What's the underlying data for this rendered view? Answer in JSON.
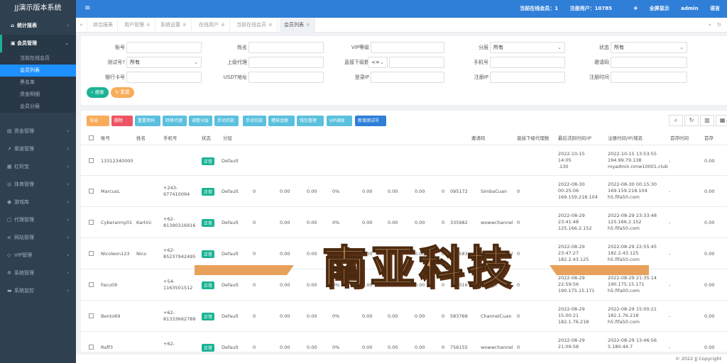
{
  "brand": "JJ演示版本系统",
  "topbar": {
    "online": "当前在线会员：1",
    "registered": "注册用户：10785",
    "fullscreen": "全屏显示",
    "user": "admin",
    "lang": "语言"
  },
  "sidebar": {
    "stats": "统计报表",
    "members": "会员管理",
    "members_sub": [
      "当前在线会员",
      "会员列表",
      "黑名单",
      "资金明细",
      "会员分层"
    ],
    "others": [
      "资金管理",
      "渠道管理",
      "红利宝",
      "体育管理",
      "游戏库",
      "代理管理",
      "网站管理",
      "VIP管理",
      "系统管理",
      "系统监控"
    ]
  },
  "tabs": [
    "综合报表",
    "用户管理",
    "系统设置",
    "在线用户",
    "当前在线会员",
    "会员列表"
  ],
  "search": {
    "labels": [
      "账号",
      "姓名",
      "VIP等级",
      "分层",
      "状态",
      "测试号?",
      "上级代理",
      "直接下级数",
      "手机号",
      "邀请码",
      "银行卡号",
      "USDT地址",
      "登录IP",
      "注册IP",
      "注册时间"
    ],
    "layer_value": "所有",
    "status_value": "所有",
    "test_value": "所有",
    "op_value": "<=",
    "search_btn": "搜索",
    "reset_btn": "重置"
  },
  "toolbar": [
    "导出",
    "删除",
    "重置密码",
    "转移代理",
    "调整分层",
    "手动存款",
    "手动存款",
    "稽核金额",
    "钱包管理",
    "VIP调级",
    "新增测试号"
  ],
  "toolbar_colors": [
    "#f8ac59",
    "#ed5565",
    "#5bc0de",
    "#5bc0de",
    "#5bc0de",
    "#5bc0de",
    "#5bc0de",
    "#5bc0de",
    "#5bc0de",
    "#5bc0de",
    "#2f7fd8"
  ],
  "columns": [
    "账号",
    "姓名",
    "手机号",
    "状态",
    "分层",
    "",
    "",
    "",
    "",
    "",
    "",
    "",
    "",
    "邀请码",
    "",
    "直接下级代理数",
    "最后活跃时间/IP",
    "注册时间/IP/域名",
    "首存时间",
    "首存"
  ],
  "rows": [
    {
      "account": "13312340000",
      "name": "",
      "phone": "",
      "status": "正常",
      "layer": "Default",
      "v": [
        "",
        "",
        "",
        "",
        "",
        "",
        "",
        "",
        ""
      ],
      "code": "",
      "src": "",
      "sub": "",
      "last": "2022-10-15\n14:05\n.130",
      "reg": "2022-10-15 13:53:55\n194.99.79.138\nmyadmin.nmw10001.club",
      "first": "-",
      "amt": "0.00"
    },
    {
      "account": "MarcusL",
      "name": "",
      "phone": "+243-\n977410094",
      "status": "正常",
      "layer": "Default",
      "v": [
        "0",
        "0.00",
        "0.00",
        "0%",
        "0.00",
        "0.00",
        "0.00",
        "0",
        "095172"
      ],
      "code": "095172",
      "src": "SimbaCuan",
      "sub": "0",
      "last": "2022-08-30\n00:25:06\n169.159.218.104",
      "reg": "2022-08-30 00:15:30\n169.159.218.104\nh5.fifa50.com",
      "first": "-",
      "amt": "0.00"
    },
    {
      "account": "Cyberarmy01",
      "name": "Kartini",
      "phone": "+62-\n81390316916",
      "status": "正常",
      "layer": "Default",
      "v": [
        "0",
        "0.00",
        "0.00",
        "0%",
        "0.00",
        "0.00",
        "0.00",
        "0",
        "335982"
      ],
      "code": "335982",
      "src": "wowwchannel",
      "sub": "0",
      "last": "2022-08-29\n23:41:48\n125.166.2.152",
      "reg": "2022-08-29 23:33:48\n125.166.2.152\nh5.fifa50.com",
      "first": "-",
      "amt": "0.00"
    },
    {
      "account": "Nicoleon123",
      "name": "Nico",
      "phone": "+62-\n85237942495",
      "status": "正常",
      "layer": "Default",
      "v": [
        "0",
        "0.00",
        "0.00",
        "0%",
        "0.00",
        "0.00",
        "0.00",
        "0",
        "376583"
      ],
      "code": "376583",
      "src": "wowwchannel",
      "sub": "0",
      "last": "2022-08-29\n23:47:27\n182.2.43.125",
      "reg": "2022-08-29 22:55:45\n182.2.43.125\nh5.fifa50.com",
      "first": "-",
      "amt": "0.00"
    },
    {
      "account": "Facu09",
      "name": "",
      "phone": "+54-\n1163501512",
      "status": "正常",
      "layer": "Default",
      "v": [
        "0",
        "0.00",
        "0.00",
        "0%",
        "0.00",
        "0.00",
        "0.00",
        "0",
        "341316"
      ],
      "code": "341316",
      "src": "Arielg3",
      "sub": "0",
      "last": "2022-08-29\n22:59:56\n190.175.15.171",
      "reg": "2022-08-29 21:35:14\n190.175.15.171\nh5.fifa00.com",
      "first": "-",
      "amt": "0.00"
    },
    {
      "account": "Bento69",
      "name": "",
      "phone": "+62-\n81333662789",
      "status": "正常",
      "layer": "Default",
      "v": [
        "0",
        "0.00",
        "0.00",
        "0%",
        "0.00",
        "0.00",
        "0.00",
        "0",
        "583768"
      ],
      "code": "583768",
      "src": "ChannelCuan",
      "sub": "0",
      "last": "2022-08-29\n15:00:21\n182.1.76.218",
      "reg": "2022-08-29 15:00:21\n182.1.76.218\nh5.fifa50.com",
      "first": "-",
      "amt": "0.00"
    },
    {
      "account": "Raff3",
      "name": "",
      "phone": "+62-\n",
      "status": "正常",
      "layer": "Default",
      "v": [
        "0",
        "0.00",
        "0.00",
        "0%",
        "0.00",
        "0.00",
        "0.00",
        "0",
        "756155"
      ],
      "code": "756155",
      "src": "wowwchannel",
      "sub": "0",
      "last": "2022-08-29\n21:09:58",
      "reg": "2022-08-29 13:46:56\n5.180.44.7",
      "first": "-",
      "amt": "0.00"
    }
  ],
  "watermark": "南亚科技",
  "footer": "© 2022 JJ Copyright",
  "colors": {
    "sidebar": "#2f4050",
    "topbar": "#2f7fd8",
    "accent": "#1ab394",
    "active": "#1e90ff"
  }
}
